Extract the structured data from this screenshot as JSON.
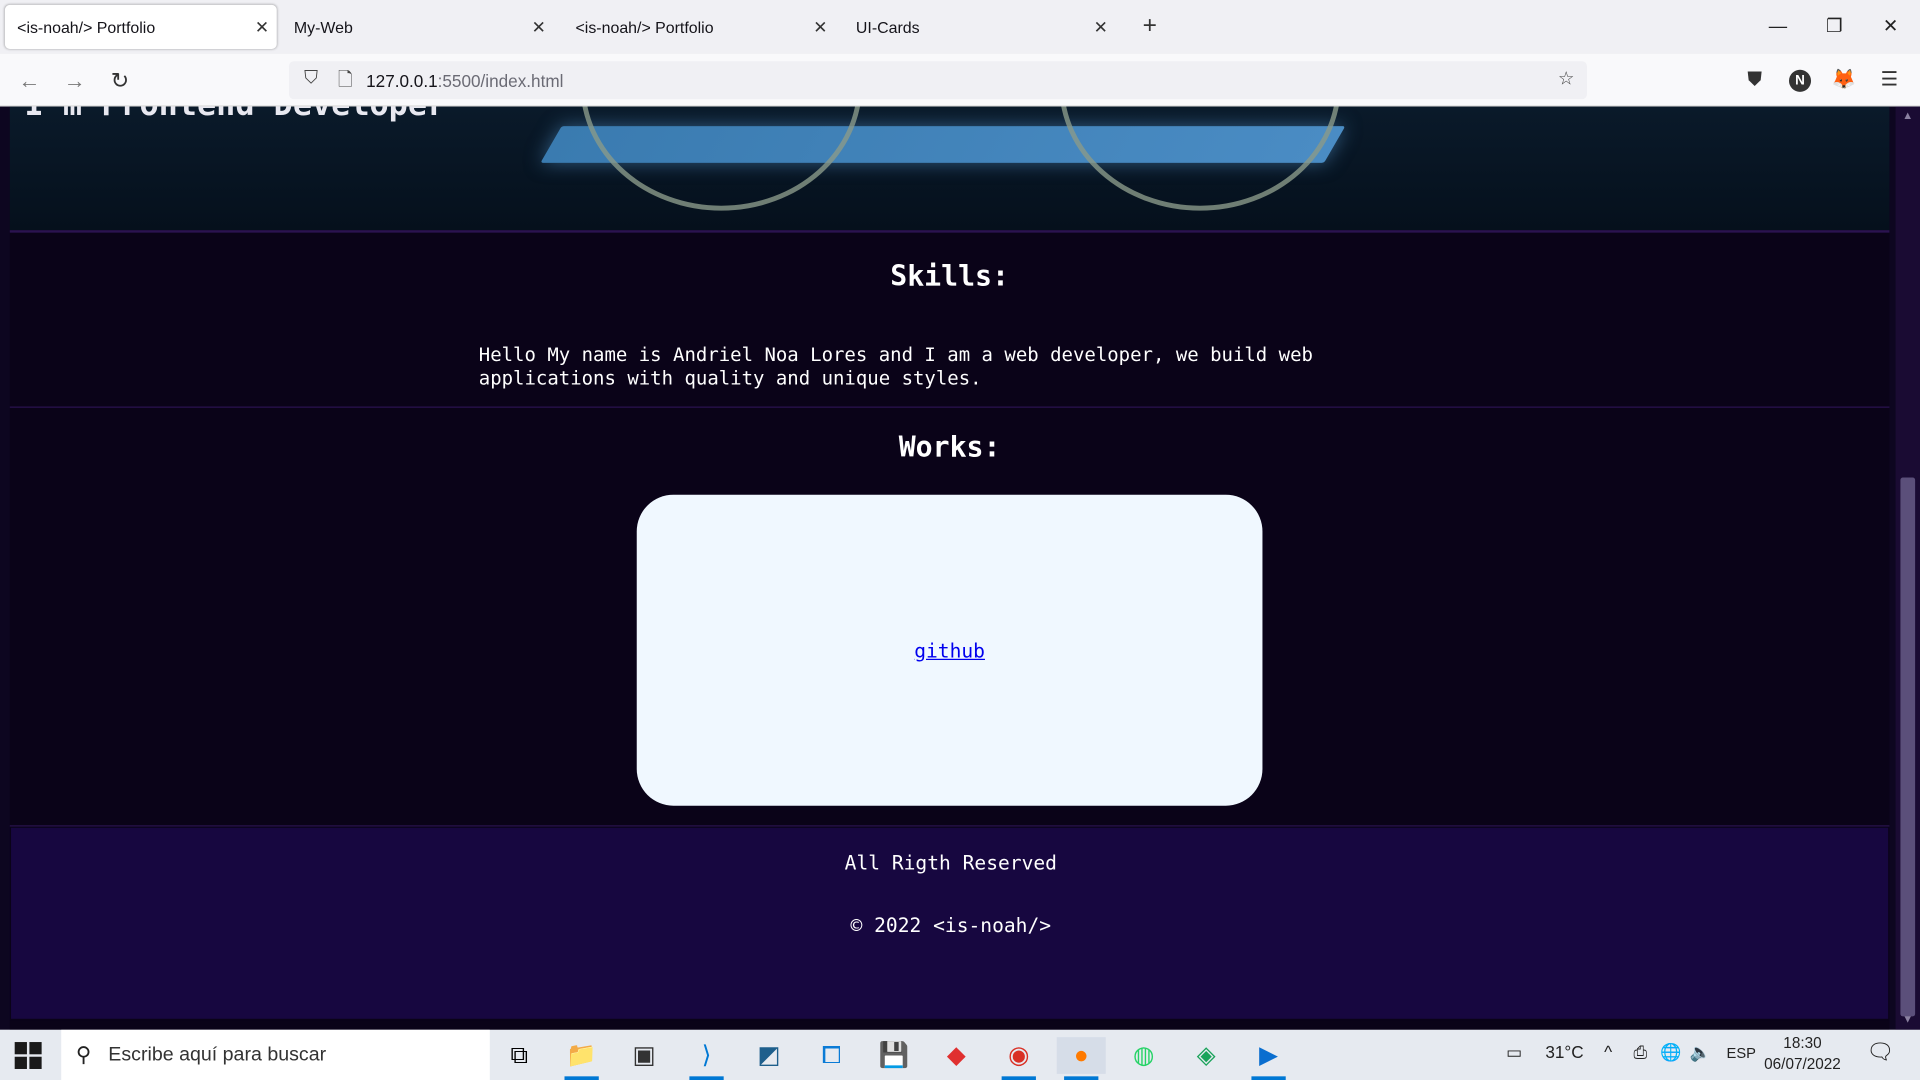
{
  "browser": {
    "tabs": [
      {
        "title": "<is-noah/> Portfolio",
        "active": true
      },
      {
        "title": "My-Web",
        "active": false
      },
      {
        "title": "<is-noah/> Portfolio",
        "active": false
      },
      {
        "title": "UI-Cards",
        "active": false
      }
    ],
    "url_host": "127.0.0.1",
    "url_path": ":5500/index.html",
    "avatar_letter": "N"
  },
  "page": {
    "hero_title": "I'm Frontend Developer",
    "skills": {
      "title": "Skills:",
      "text": "Hello My name is Andriel Noa Lores and I am a web developer, we build web applications with quality and unique styles."
    },
    "works": {
      "title": "Works:",
      "link_label": "github"
    },
    "footer": {
      "line1": "All Rigth Reserved",
      "line2": "© 2022 <is-noah/>"
    }
  },
  "taskbar": {
    "search_placeholder": "Escribe aquí para buscar",
    "temperature": "31°C",
    "language": "ESP",
    "time": "18:30",
    "date": "06/07/2022"
  },
  "colors": {
    "page_bg": "#0a0318",
    "footer_bg": "#170740",
    "card_bg": "#f0f8ff",
    "link": "#0000ee"
  }
}
